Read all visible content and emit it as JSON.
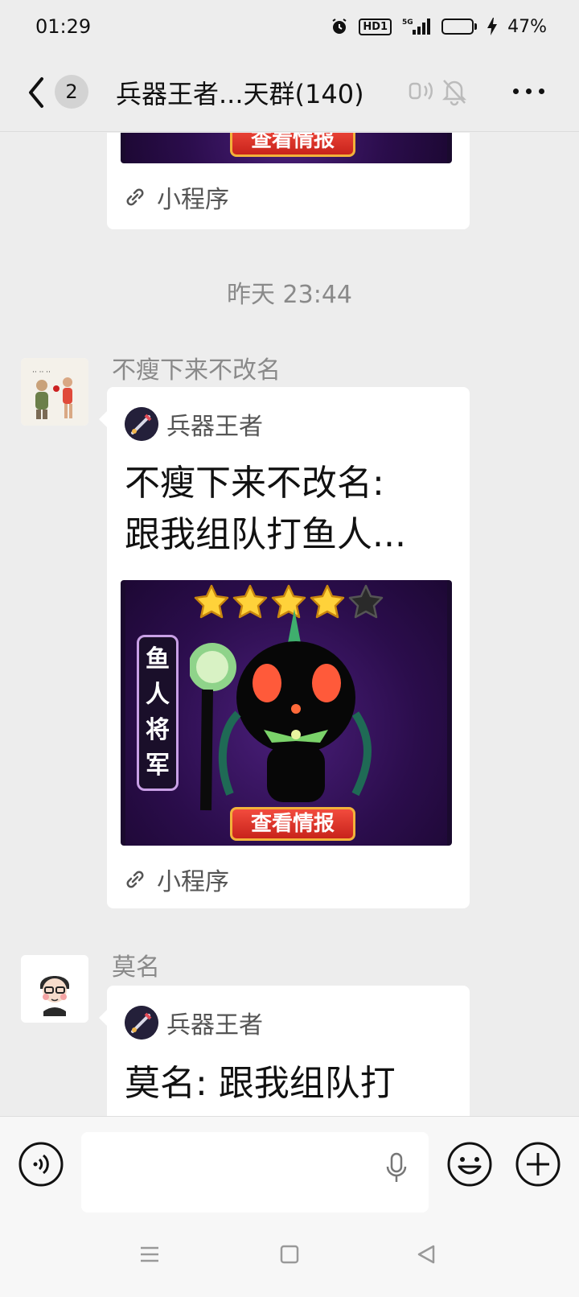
{
  "status_bar": {
    "time": "01:29",
    "network": "5G",
    "hd_label": "HD1",
    "battery_percent_label": "47%",
    "battery_level": 0.47
  },
  "header": {
    "unread_count": "2",
    "title": "兵器王者...天群(140)"
  },
  "messages": {
    "first_card": {
      "mini_label": "小程序",
      "button_text": "查看情报"
    },
    "timestamp": "昨天 23:44",
    "msg1": {
      "sender": "不瘦下来不改名",
      "app_name": "兵器王者",
      "text_line1": "不瘦下来不改名:",
      "text_line2": "跟我组队打鱼人...",
      "thumb_side": [
        "鱼",
        "人",
        "将",
        "军"
      ],
      "thumb_button": "查看情报",
      "stars_filled": 4,
      "stars_total": 5,
      "mini_label": "小程序"
    },
    "msg2": {
      "sender": "莫名",
      "app_name": "兵器王者",
      "text_line1": "莫名:  跟我组队打"
    }
  },
  "input": {
    "value": "",
    "placeholder": ""
  },
  "colors": {
    "background": "#ededed",
    "bubble": "#ffffff",
    "thumb_purple": "#2b0d4c",
    "button_red": "#d8362a"
  }
}
